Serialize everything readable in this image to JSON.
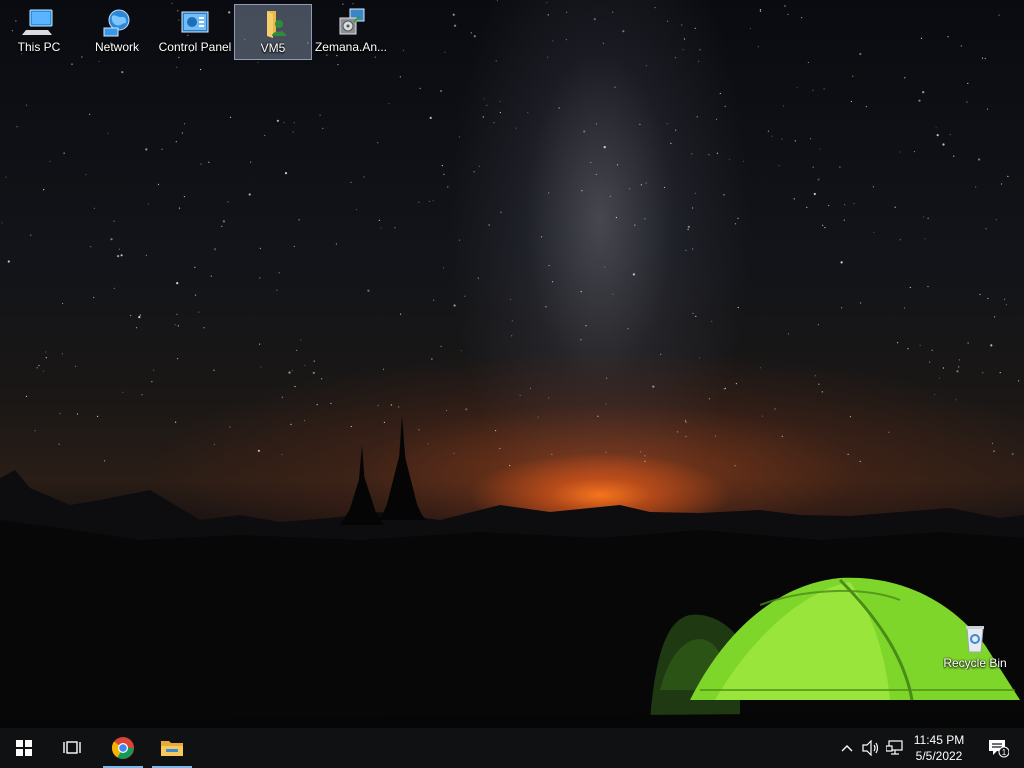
{
  "desktop": {
    "icons": [
      {
        "label": "This PC"
      },
      {
        "label": "Network"
      },
      {
        "label": "Control Panel"
      },
      {
        "label": "VM5"
      },
      {
        "label": "Zemana.An..."
      }
    ],
    "recycle_bin": {
      "label": "Recycle Bin"
    }
  },
  "taskbar": {
    "clock": {
      "time": "11:45 PM",
      "date": "5/5/2022"
    },
    "notification_count": "1"
  },
  "colors": {
    "taskbar_bg": "#101113",
    "active_indicator": "#76b9ed",
    "tent_green": "#7fd62a"
  }
}
